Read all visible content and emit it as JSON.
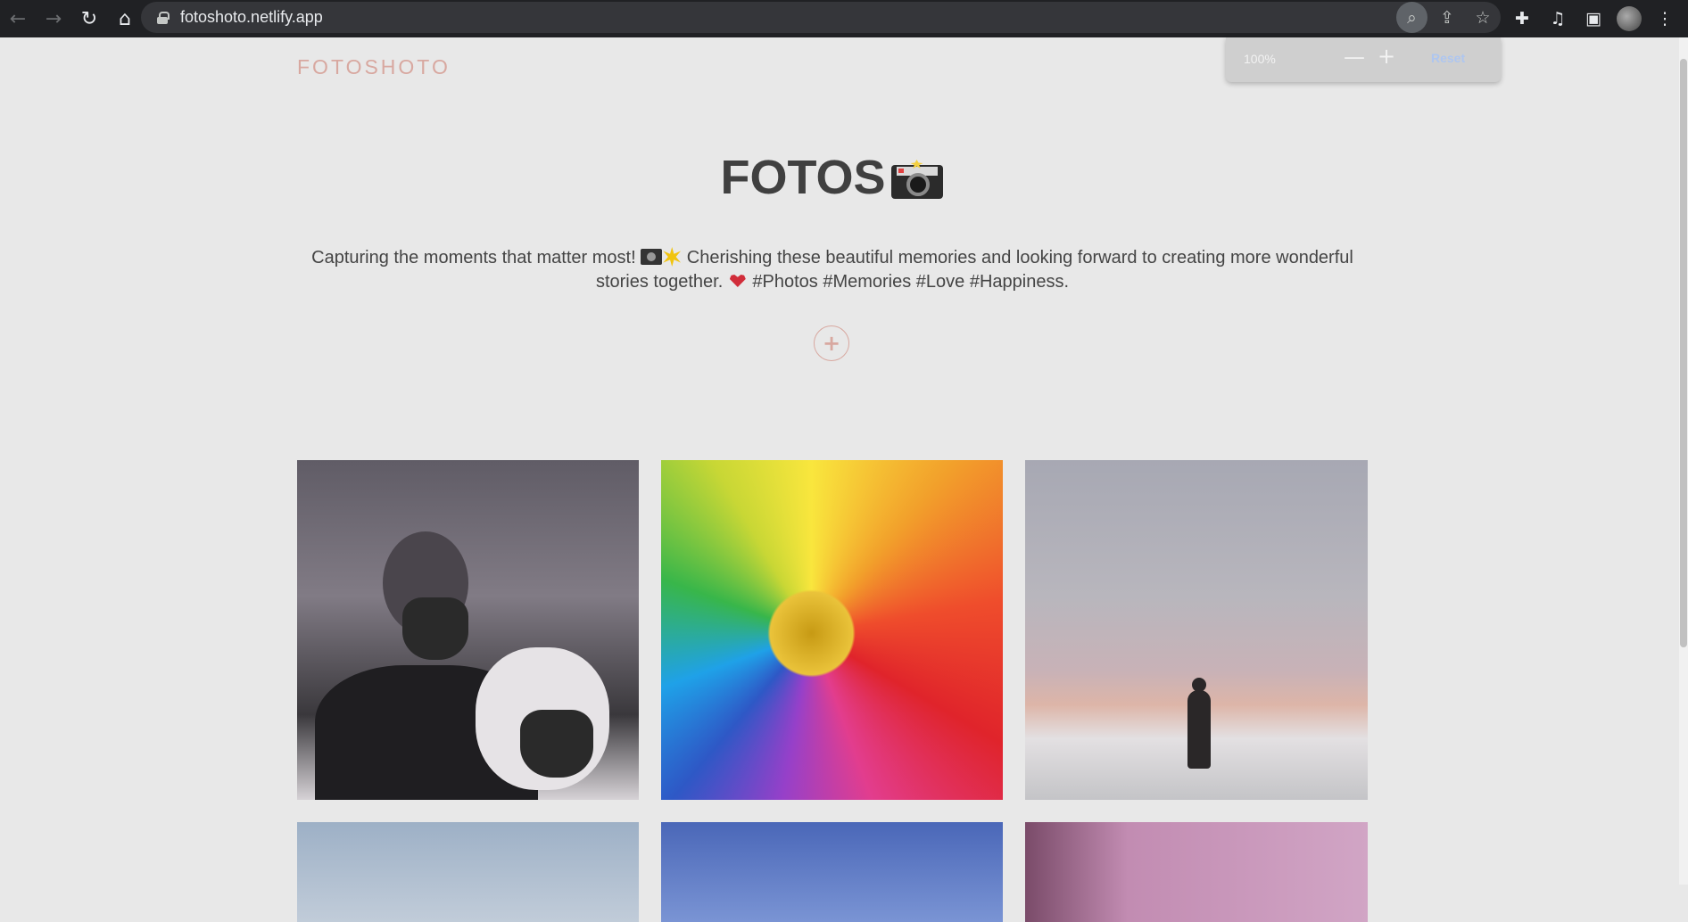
{
  "browser": {
    "url": "fotoshoto.netlify.app",
    "icons": [
      "back-icon",
      "forward-icon",
      "reload-icon",
      "home-icon",
      "lock-icon",
      "zoom-icon",
      "share-icon",
      "star-icon",
      "extensions-icon",
      "media-icon",
      "sidepanel-icon",
      "menu-icon"
    ]
  },
  "zoom": {
    "level": "100%",
    "minus": "—",
    "plus": "+",
    "reset": "Reset"
  },
  "site": {
    "brand": "FOTOSHOTO",
    "title": "FOTOS",
    "desc_part1": "Capturing the moments that matter most!",
    "desc_part2": "Cherishing these beautiful memories and looking forward to creating more wonderful stories together.",
    "desc_part3": "#Photos #Memories #Love #Happiness.",
    "add_label": "+"
  },
  "colors": {
    "accent": "#d8a8a0",
    "background": "#e8e8e8",
    "title": "#404040"
  }
}
